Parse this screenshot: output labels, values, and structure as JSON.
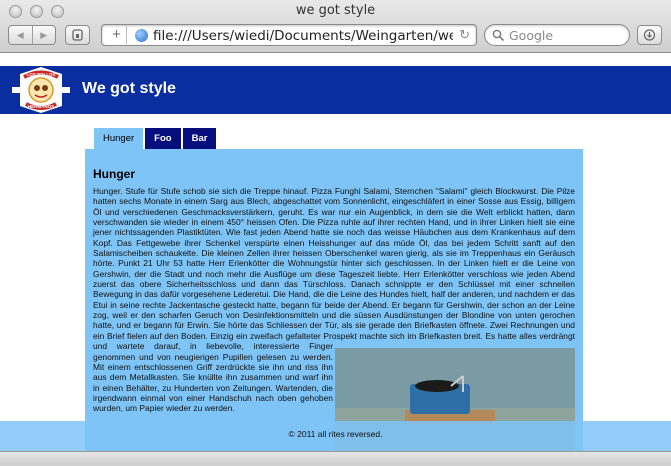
{
  "window": {
    "title": "we got style"
  },
  "toolbar": {
    "back_icon": "back-arrow-icon",
    "forward_icon": "forward-arrow-icon",
    "address": "file:///Users/wiedi/Documents/Weingarten/webgot",
    "search_placeholder": "Google"
  },
  "site": {
    "logo_text_top": "LOS POLLOS",
    "logo_text_bottom": "HERMANOS",
    "title": "We got style",
    "header_color": "#0a2ea0"
  },
  "tabs": [
    {
      "label": "Hunger",
      "active": true
    },
    {
      "label": "Foo",
      "active": false
    },
    {
      "label": "Bar",
      "active": false
    }
  ],
  "content": {
    "heading": "Hunger",
    "text": "Hunger. Stufe für Stufe schob sie sich die Treppe hinauf. Pizza Funghi Salami, Sternchen \"Salami\" gleich Blockwurst. Die Pilze hatten sechs Monate in einem Sarg aus Blech, abgeschattet vom Sonnenlicht, eingeschläfert in einer Sosse aus Essig, billigem Öl und verschiedenen Geschmacksverstärkern, geruht. Es war nur ein Augenblick, in dem sie die Welt erblickt hatten, dann verschwanden sie wieder in einem 450° heissen Ofen. Die Pizza ruhte auf ihrer rechten Hand, und in ihrer Linken hielt sie eine jener nichtssagenden Plastiktüten. Wie fast jeden Abend hatte sie noch das weisse Häubchen aus dem Krankenhaus auf dem Kopf. Das Fettgewebe ihrer Schenkel verspürte einen Heisshunger auf das müde Öl, das bei jedem Schritt sanft auf den Salamischeiben schaukelte. Die kleinen Zellen ihrer heissen Oberschenkel waren gierig, als sie im Treppenhaus ein Geräusch hörte. Punkt 21 Uhr 53 hatte Herr Erlenkötter die Wohnungstür hinter sich geschlossen. In der Linken hielt er die Leine von Gershwin, der die Stadt und noch mehr die Ausflüge um diese Tageszeit liebte. Herr Erlenkötter verschloss wie jeden Abend zuerst das obere Sicherheitsschloss und dann das Türschloss. Danach schnippte er den Schlüssel mit einer schnellen Bewegung in das dafür vorgesehene Lederetui. Die Hand, die die Leine des Hundes hielt, half der anderen, und nachdem er das Etui in seine rechte Jackentasche gesteckt hatte, begann für beide der Abend. Er begann für Gershwin, der schon an der Leine zog, weil er den scharfen Geruch von Desinfektionsmitteln und die süssen Ausdünstungen der Blondine von unten gerochen hatte, und er begann für Erwin. Sie hörte das Schliessen der Tür, als sie gerade den Briefkasten öffnete. Zwei Rechnungen und ein Brief fielen auf den Boden. Einzig ein zweifach gefalteter Prospekt machte sich im Briefkasten breit. Es hatte alles verdrängt und wartete darauf, in liebevolle, interessierte Finger genommen und von neugierigen Pupillen gelesen zu werden. Mit einem entschlossenen Griff zerdrückte sie ihn und riss ihn aus dem Metallkasten. Sie knüllte ihn zusammen und warf ihn in einen Behälter, zu Hunderten von Zeitungen. Wartenden, die irgendwann einmal von einer Handschuh nach oben gehoben wurden, um Papier wieder zu werden."
  },
  "footer": {
    "text": "© 2011 all rites reversed."
  },
  "colors": {
    "panel": "#7ec4f7",
    "tab_inactive": "#060e7e"
  }
}
